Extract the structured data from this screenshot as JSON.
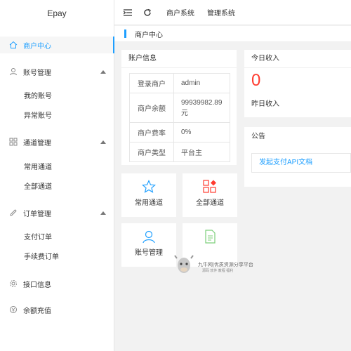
{
  "brand": "Epay",
  "sidebar": {
    "items": [
      {
        "label": "商户中心",
        "icon": "home-icon"
      },
      {
        "label": "账号管理",
        "icon": "user-icon"
      },
      {
        "label": "通道管理",
        "icon": "grid-icon"
      },
      {
        "label": "订单管理",
        "icon": "pen-icon"
      },
      {
        "label": "接口信息",
        "icon": "gear-icon"
      },
      {
        "label": "余额充值",
        "icon": "wallet-icon"
      }
    ],
    "sub": {
      "account": [
        "我的账号",
        "异常账号"
      ],
      "channel": [
        "常用通道",
        "全部通道"
      ],
      "order": [
        "支付订单",
        "手续费订单"
      ]
    }
  },
  "topbar": {
    "links": [
      "商户系统",
      "管理系统"
    ]
  },
  "breadcrumb": "商户中心",
  "account_info": {
    "title": "账户信息",
    "rows": [
      {
        "k": "登录商户",
        "v": "admin"
      },
      {
        "k": "商户余额",
        "v": "99939982.89元"
      },
      {
        "k": "商户费率",
        "v": "0%"
      },
      {
        "k": "商户类型",
        "v": "平台主"
      }
    ]
  },
  "income": {
    "title": "今日收入",
    "value": "0",
    "label": "昨日收入"
  },
  "notice": {
    "title": "公告",
    "item": "发起支付API文档"
  },
  "tiles": [
    "常用通道",
    "全部通道",
    "账号管理"
  ],
  "watermark": {
    "line1": "九牛网|优质资源分享平台",
    "line2": "源码 软件 教程 福利"
  },
  "colors": {
    "accent": "#1e9fff",
    "income": "#ff3b2f",
    "tile_red": "#ff3b2f"
  }
}
